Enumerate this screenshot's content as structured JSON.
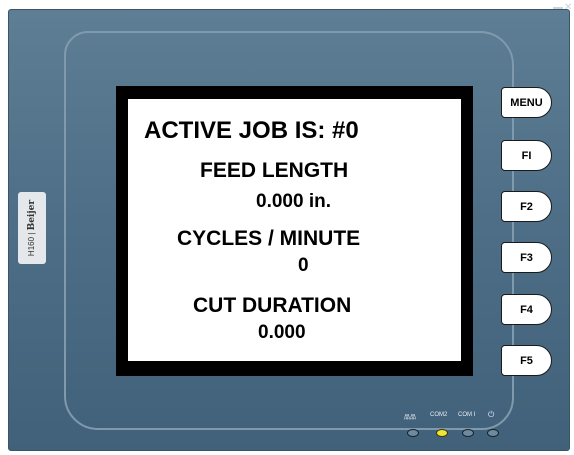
{
  "window": {
    "minimize_glyph": "▬",
    "close_glyph": "✕"
  },
  "brand": {
    "model": "H160 |",
    "name": "Beijer"
  },
  "screen": {
    "active_job": "ACTIVE JOB IS: #0",
    "feed_length_label": "FEED LENGTH",
    "feed_length_value": "0.000 in.",
    "cycles_label": "CYCLES / MINUTE",
    "cycles_value": "0",
    "cut_duration_label": "CUT DURATION",
    "cut_duration_value": "0.000"
  },
  "keys": {
    "menu": "MENU",
    "f1": "FI",
    "f2": "F2",
    "f3": "F3",
    "f4": "F4",
    "f5": "F5"
  },
  "indicators": {
    "run_label": "品品",
    "com2_label": "COM2",
    "com1_label": "COM I",
    "power_label": "⏻",
    "states": [
      "off",
      "on",
      "off",
      "off"
    ],
    "on_color": "#f0e535",
    "off_color": "#6f8a9d"
  },
  "colors": {
    "bezel": "#4e6f87",
    "screen_border": "#000000",
    "screen_bg": "#ffffff"
  }
}
